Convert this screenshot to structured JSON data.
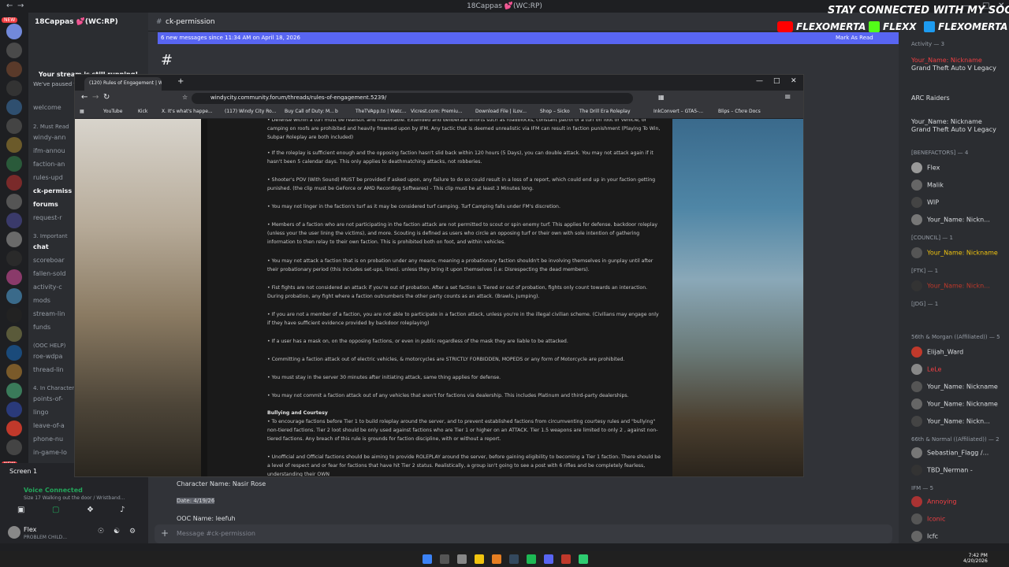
{
  "window": {
    "title": "18Cappas 💕(WC:RP)"
  },
  "server": {
    "name": "18Cappas 💕(WC:RP)"
  },
  "stream_notice": {
    "title": "Your stream is still running!",
    "subtitle": "We've paused this preview to save your resources."
  },
  "channels": [
    {
      "label": "welcome"
    },
    {
      "label": "2. Must Read",
      "category": true
    },
    {
      "label": "windy-ann"
    },
    {
      "label": "ifm-annou"
    },
    {
      "label": "faction-an"
    },
    {
      "label": "rules-upd"
    },
    {
      "label": "ck-permiss",
      "active": true
    },
    {
      "label": "forums"
    },
    {
      "label": "request-r"
    },
    {
      "label": "3. Important",
      "category": true
    },
    {
      "label": "chat"
    },
    {
      "label": "scoreboar"
    },
    {
      "label": "fallen-sold"
    },
    {
      "label": "activity-c"
    },
    {
      "label": "mods"
    },
    {
      "label": "stream-lin"
    },
    {
      "label": "funds"
    },
    {
      "label": "(OOC HELP)",
      "category": true
    },
    {
      "label": "roe-wdpa"
    },
    {
      "label": "thread-lin"
    },
    {
      "label": "4. In Character In",
      "category": true
    },
    {
      "label": "points-of-"
    },
    {
      "label": "lingo"
    },
    {
      "label": "leave-of-a"
    },
    {
      "label": "phone-nu"
    },
    {
      "label": "in-game-lo"
    }
  ],
  "voice": {
    "screen_label": "Screen 1",
    "status": "Voice Connected",
    "detail": "Size 17 Walking out the door / Wristband...",
    "user": "Flex",
    "user_status": "PROBLEM CHILD..."
  },
  "chat": {
    "channel_name": "ck-permission",
    "new_messages": "6 new messages since 11:34 AM on April 18, 2026",
    "mark_read": "Mark As Read",
    "message_lines": [
      "Character Name: Nasir Rose",
      "Date: 4/19/26",
      "OOC Name: leefuh"
    ],
    "composer_placeholder": "Message #ck-permission"
  },
  "overlay": {
    "socials": "STAY CONNECTED WITH MY SOCIALS",
    "yt": "FLEXOMERTA",
    "kick": "FLEXX",
    "x": "FLEXOMERTA"
  },
  "browser": {
    "tab_title": "(120) Rules of Engagement | W",
    "url": "windycity.community.forum/threads/rules-of-engagement.5239/",
    "bookmarks": [
      "YouTube",
      "Kick",
      "X. It's what's happe...",
      "(117) Windy City Ro...",
      "Buy Call of Duty: M...",
      "b",
      "TheTVApp.to | Watc...",
      "Vicrest.com: Premiu...",
      "Download File | iLov...",
      "Shop – Sicko",
      "The Drill Era Roleplay",
      "InkConvert – GTA5-...",
      "Blips – Cfxre Docs"
    ]
  },
  "article": {
    "paragraphs": [
      "• Defense within a turf must be realistic and reasonable. Extended and deliberate efforts such as roadblocks, constant patrol of a turf on foot or vehicle, or camping on roofs are prohibited and heavily frowned upon by IFM. Any tactic that is deemed unrealistic via IFM can result in faction punishment (Playing To Win, Subpar Roleplay are both included)",
      "• If the roleplay is sufficient enough and the opposing faction hasn't slid back within 120 hours (5 Days), you can double attack. You may not attack again if it hasn't been 5 calendar days. This only applies to deathmatching attacks, not robberies.",
      "• Shooter's POV (With Sound) MUST be provided if asked upon, any failure to do so could result in a loss of a report, which could end up in your faction getting punished. (the clip must be GeForce or AMD Recording Softwares) - This clip must be at least 3 Minutes long.",
      "• You may not linger in the faction's turf as it may be considered turf camping. Turf Camping falls under FM's discretion.",
      "• Members of a faction who are not participating in the faction attack are not permitted to scout or spin enemy turf. This applies for defense. backdoor roleplay (unless your the user lining the victims), and more. Scouting is defined as users who circle an opposing turf or their own with sole intention of gathering information to then relay to their own faction. This is prohibited both on foot, and within vehicles.",
      "• You may not attack a faction that is on probation under any means, meaning a probationary faction shouldn't be involving themselves in gunplay until after their probationary period (this includes set-ups, lines). unless they bring it upon themselves (i.e: Disrespecting the dead members).",
      "• Fist fights are not considered an attack if you're out of probation. After a set faction is Tiered or out of probation, fights only count towards an interaction. During probation, any fight where a faction outnumbers the other party counts as an attack. (Brawls, Jumping).",
      "• If you are not a member of a faction, you are not able to participate in a faction attack, unless you're in the illegal civilian scheme. (Civilians may engage only if they have sufficient evidence provided by backdoor roleplaying)",
      "• If a user has a mask on, on the opposing factions, or even in public regardless of the mask they are liable to be attacked.",
      "• Committing a faction attack out of electric vehicles, & motorcycles are STRICTLY FORBIDDEN, MOPEDS or any form of Motorcycle are prohibited.",
      "• You must stay in the server 30 minutes after initiating attack, same thing applies for defense.",
      "• You may not commit a faction attack out of any vehicles that aren't for factions via dealership. This includes Platinum and third-party dealerships.",
      "Bullying and Courtesy",
      "• To encourage factions before Tier 1 to build roleplay around the server, and to prevent established factions from circumventing courtesy rules and \"bullying\" non-tiered factions. Tier 2 loot should be only used against factions who are Tier 1 or higher on an ATTACK. Tier 1.5 weapons are limited to only 2 , against non-tiered factions. Any breach of this rule is grounds for faction discipline, with or without a report.",
      "• Unofficial and Official factions should be aiming to provide ROLEPLAY around the server, before gaining eligibility to becoming a Tier 1 faction. There should be a level of respect and or fear for factions that have hit Tier 2 status. Realistically, a group isn't going to see a post with 6 rifles and be completely fearless, understanding their OWN"
    ]
  },
  "members": {
    "groups": [
      {
        "header": "Activity — 3",
        "items": [
          "Your_Name: Nickname",
          "Grand Theft Auto V Legacy",
          "ARC Raiders",
          "Your_Name: Nickname",
          "Grand Theft Auto V Legacy"
        ]
      },
      {
        "header": "[BENEFACTORS] — 4",
        "items": [
          "Flex",
          "Malik",
          "WIP",
          "Your_Name: Nickn..."
        ]
      },
      {
        "header": "[COUNCIL] — 1",
        "items": [
          "Your_Name: Nickname"
        ]
      },
      {
        "header": "[FTK] — 1",
        "items": [
          "Your_Name: Nickn..."
        ]
      },
      {
        "header": "[JDG] — 1",
        "items": []
      },
      {
        "header": "56th & Morgan ((Affiliated)) — 5",
        "items": [
          "Elijah_Ward",
          "LeLe",
          "Your_Name: Nickname",
          "Your_Name: Nickname",
          "Your_Name: Nickn..."
        ]
      },
      {
        "header": "66th & Normal ((Affiliated)) — 2",
        "items": [
          "Sebastian_Flagg /...",
          "TBD_Nerman -"
        ]
      },
      {
        "header": "IFM — 5",
        "items": [
          "Annoying",
          "Iconic",
          "Icfc"
        ]
      }
    ]
  },
  "taskbar": {
    "time": "7:42 PM",
    "date": "4/20/2026"
  },
  "colors": {
    "accent": "#5865f2",
    "danger": "#f23f43",
    "bg": "#313338"
  }
}
